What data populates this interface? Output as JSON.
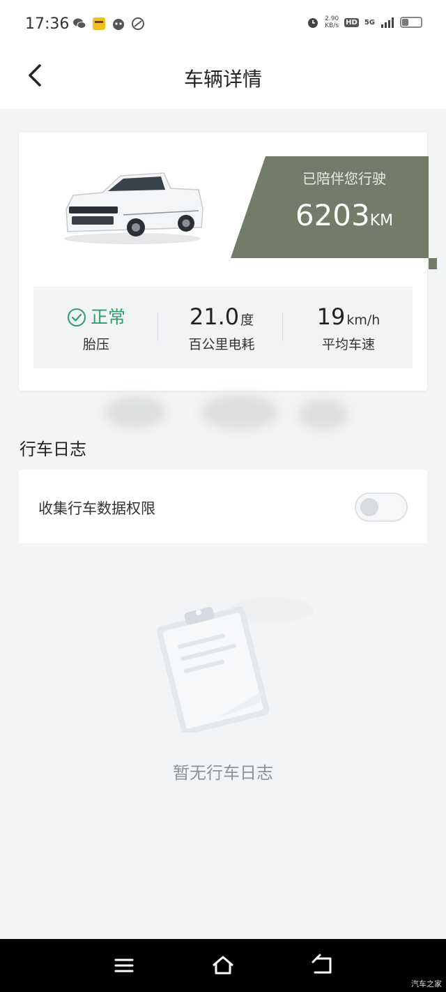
{
  "status_bar": {
    "time": "17:36",
    "net_speed_value": "2.90",
    "net_speed_unit": "KB/s",
    "hd_label": "HD",
    "network_label": "5G",
    "battery_level": 0.35,
    "left_icons": [
      "wechat-icon",
      "app-icon",
      "cat-app-icon",
      "leaf-app-icon"
    ],
    "right_icons": [
      "alarm-icon",
      "signal-icon",
      "battery-icon"
    ]
  },
  "header": {
    "title": "车辆详情",
    "back_icon": "chevron-left-icon"
  },
  "vehicle": {
    "mileage_label": "已陪伴您行驶",
    "mileage_value": "6203",
    "mileage_unit": "KM",
    "panel_color": "#737b69",
    "stats": [
      {
        "value": "正常",
        "label": "胎压",
        "icon": "check-circle-icon",
        "color": "#2f9e6e"
      },
      {
        "value": "21.0",
        "unit": "度",
        "label": "百公里电耗"
      },
      {
        "value": "19",
        "unit": "km/h",
        "label": "平均车速"
      }
    ]
  },
  "driving_log": {
    "section_title": "行车日志",
    "permission_label": "收集行车数据权限",
    "permission_enabled": false,
    "empty_text": "暂无行车日志"
  },
  "nav_bar": {
    "icons": [
      "menu-icon",
      "home-icon",
      "back-icon"
    ],
    "watermark": "汽车之家"
  }
}
